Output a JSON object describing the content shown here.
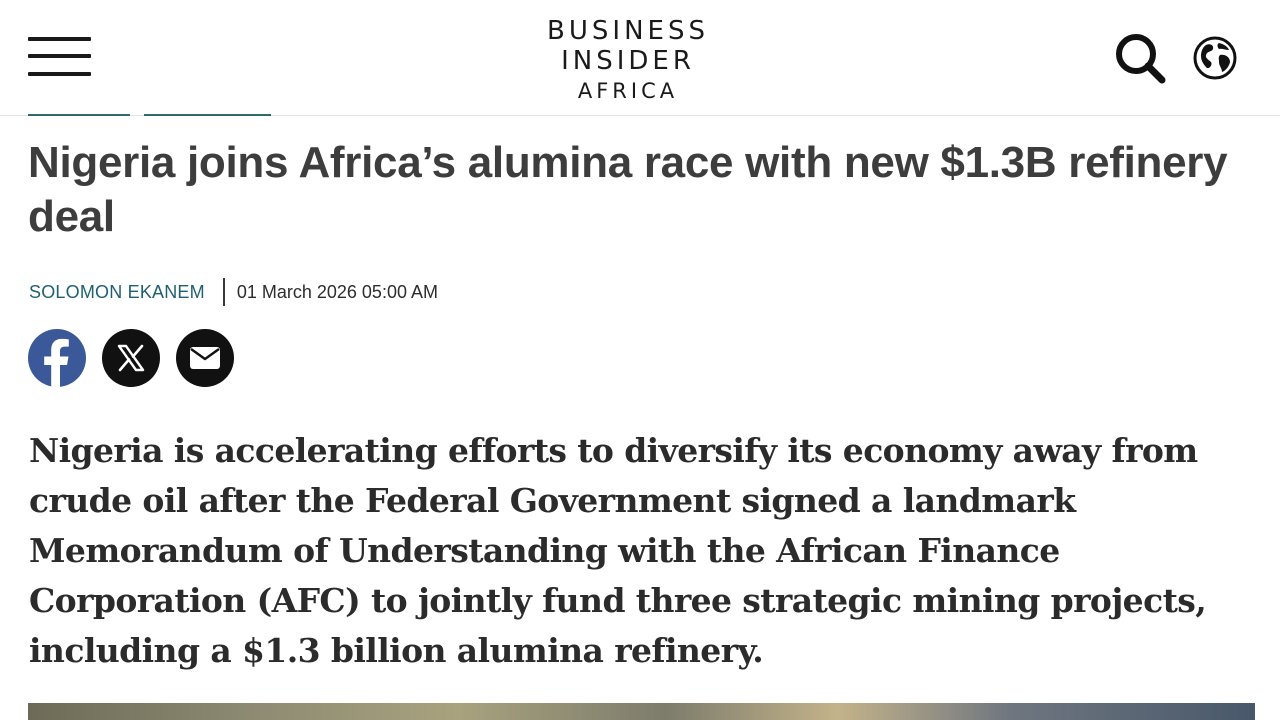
{
  "header": {
    "logo": {
      "line1": "BUSINESS",
      "line2": "INSIDER",
      "line3": "AFRICA"
    },
    "menu_icon": "hamburger-menu-icon",
    "search_icon": "search-icon",
    "globe_icon": "globe-icon"
  },
  "article": {
    "title": "Nigeria joins Africa’s alumina race with new $1.3B refinery deal",
    "author": "SOLOMON EKANEM",
    "date": "01 March 2026 05:00 AM",
    "lead": "Nigeria is accelerating efforts to diversify its economy away from crude oil after the Federal Government signed a landmark Memorandum of Understanding with the African Finance Corporation (AFC) to jointly fund three strategic mining projects, including a $1.3 billion alumina refinery."
  },
  "share": {
    "icons": [
      "facebook-icon",
      "x-icon",
      "email-icon"
    ],
    "colors": {
      "facebook": "#3b5998",
      "x": "#111111",
      "email": "#111111"
    }
  },
  "colors": {
    "author": "#1f5f73",
    "title": "#3d3d3d",
    "accent": "#2f6b6c"
  }
}
